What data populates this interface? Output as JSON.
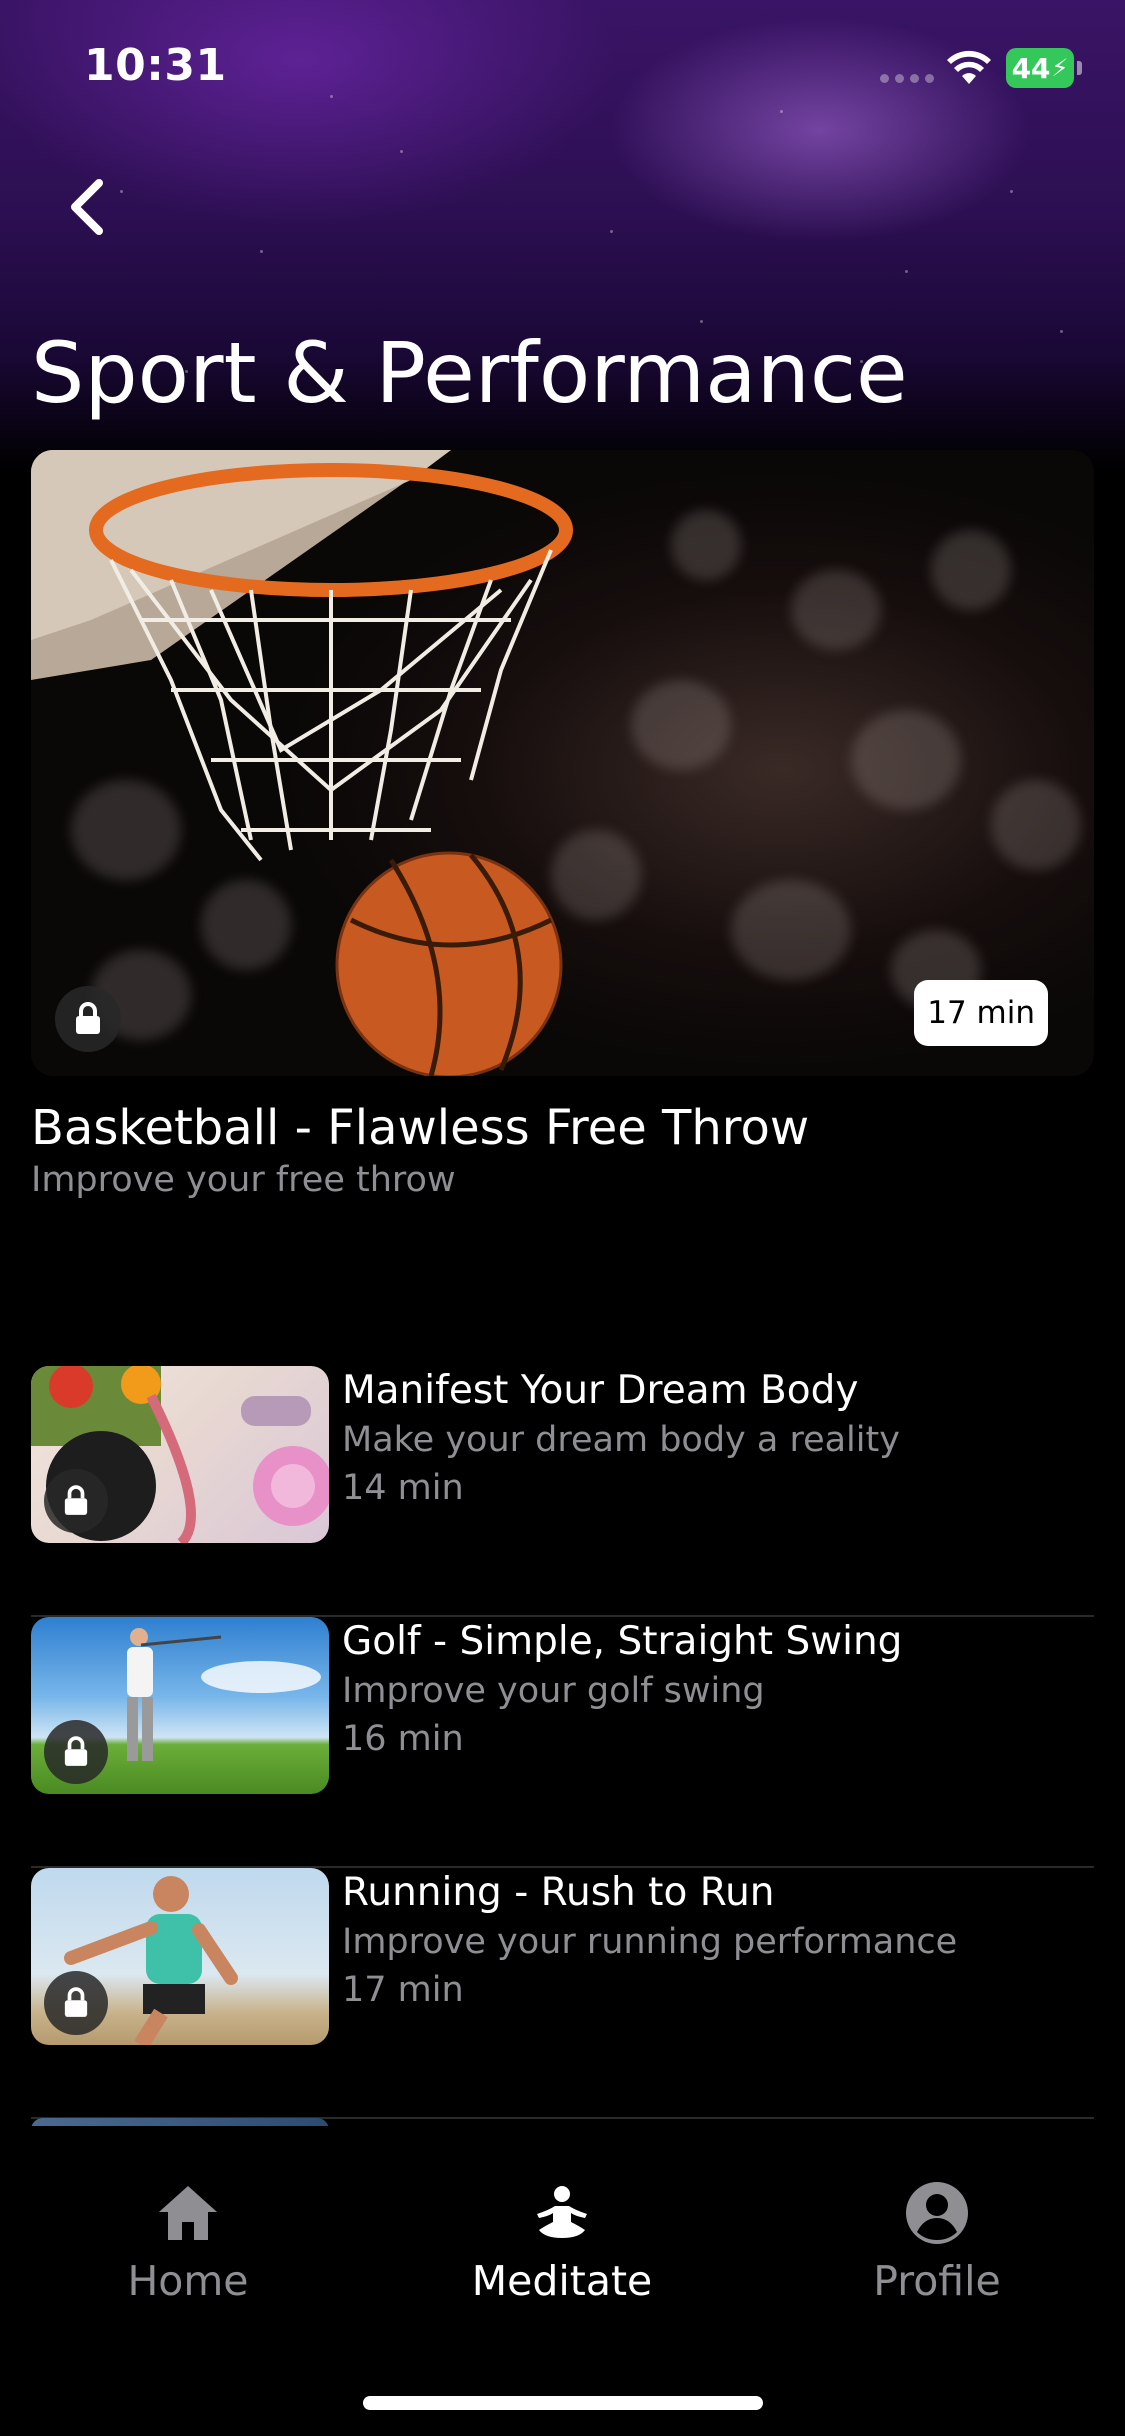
{
  "status_bar": {
    "time": "10:31",
    "battery": "44",
    "icons": [
      "cellular-signal-icon",
      "wifi-icon",
      "battery-charging-icon"
    ]
  },
  "header": {
    "back_icon": "chevron-left-icon",
    "title": "Sport & Performance"
  },
  "featured": {
    "title": "Basketball - Flawless Free Throw",
    "subtitle": "Improve your free throw",
    "duration": "17 min",
    "locked": true
  },
  "sessions": [
    {
      "title": "Manifest Your Dream Body",
      "subtitle": "Make your dream body a reality",
      "duration": "14 min",
      "locked": true
    },
    {
      "title": "Golf - Simple, Straight Swing",
      "subtitle": "Improve your golf swing",
      "duration": "16 min",
      "locked": true
    },
    {
      "title": "Running - Rush to Run",
      "subtitle": "Improve your running performance",
      "duration": "17 min",
      "locked": true
    }
  ],
  "tab_bar": {
    "tabs": [
      {
        "label": "Home",
        "icon": "home-icon",
        "active": false
      },
      {
        "label": "Meditate",
        "icon": "meditate-icon",
        "active": true
      },
      {
        "label": "Profile",
        "icon": "profile-icon",
        "active": false
      }
    ]
  },
  "colors": {
    "accent_purple": "#2c0f52",
    "muted_text": "#8e8e93",
    "battery_green": "#34c759"
  }
}
